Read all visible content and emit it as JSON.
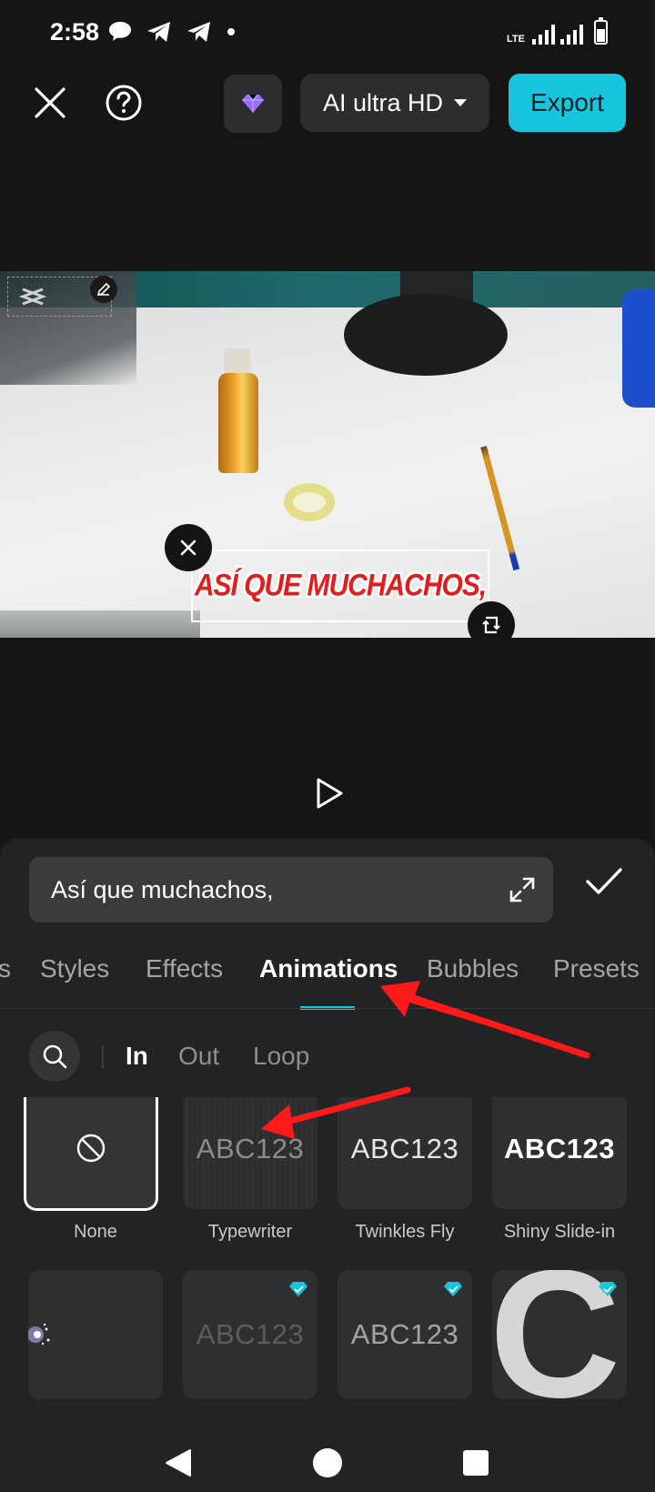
{
  "status_bar": {
    "time": "2:58",
    "network": "LTE"
  },
  "toolbar": {
    "quality_label": "AI ultra HD",
    "export_label": "Export"
  },
  "preview": {
    "overlay_text": "ASÍ QUE MUCHACHOS,"
  },
  "editor": {
    "text_value": "Así que muchachos,"
  },
  "tabs": [
    "s",
    "Styles",
    "Effects",
    "Animations",
    "Bubbles",
    "Presets"
  ],
  "active_tab": "Animations",
  "subtabs": [
    "In",
    "Out",
    "Loop"
  ],
  "active_subtab": "In",
  "animations": [
    {
      "label": "None",
      "preview": ""
    },
    {
      "label": "Typewriter",
      "preview": "ABC123"
    },
    {
      "label": "Twinkles Fly",
      "preview": "ABC123"
    },
    {
      "label": "Shiny Slide-in",
      "preview": "ABC123"
    },
    {
      "label": "",
      "preview": ""
    },
    {
      "label": "",
      "preview": "ABC123"
    },
    {
      "label": "",
      "preview": "ABC123"
    },
    {
      "label": "",
      "preview": "C"
    }
  ],
  "colors": {
    "accent": "#17c5dc",
    "panel": "#222325",
    "annotation": "#ff1a1a"
  }
}
